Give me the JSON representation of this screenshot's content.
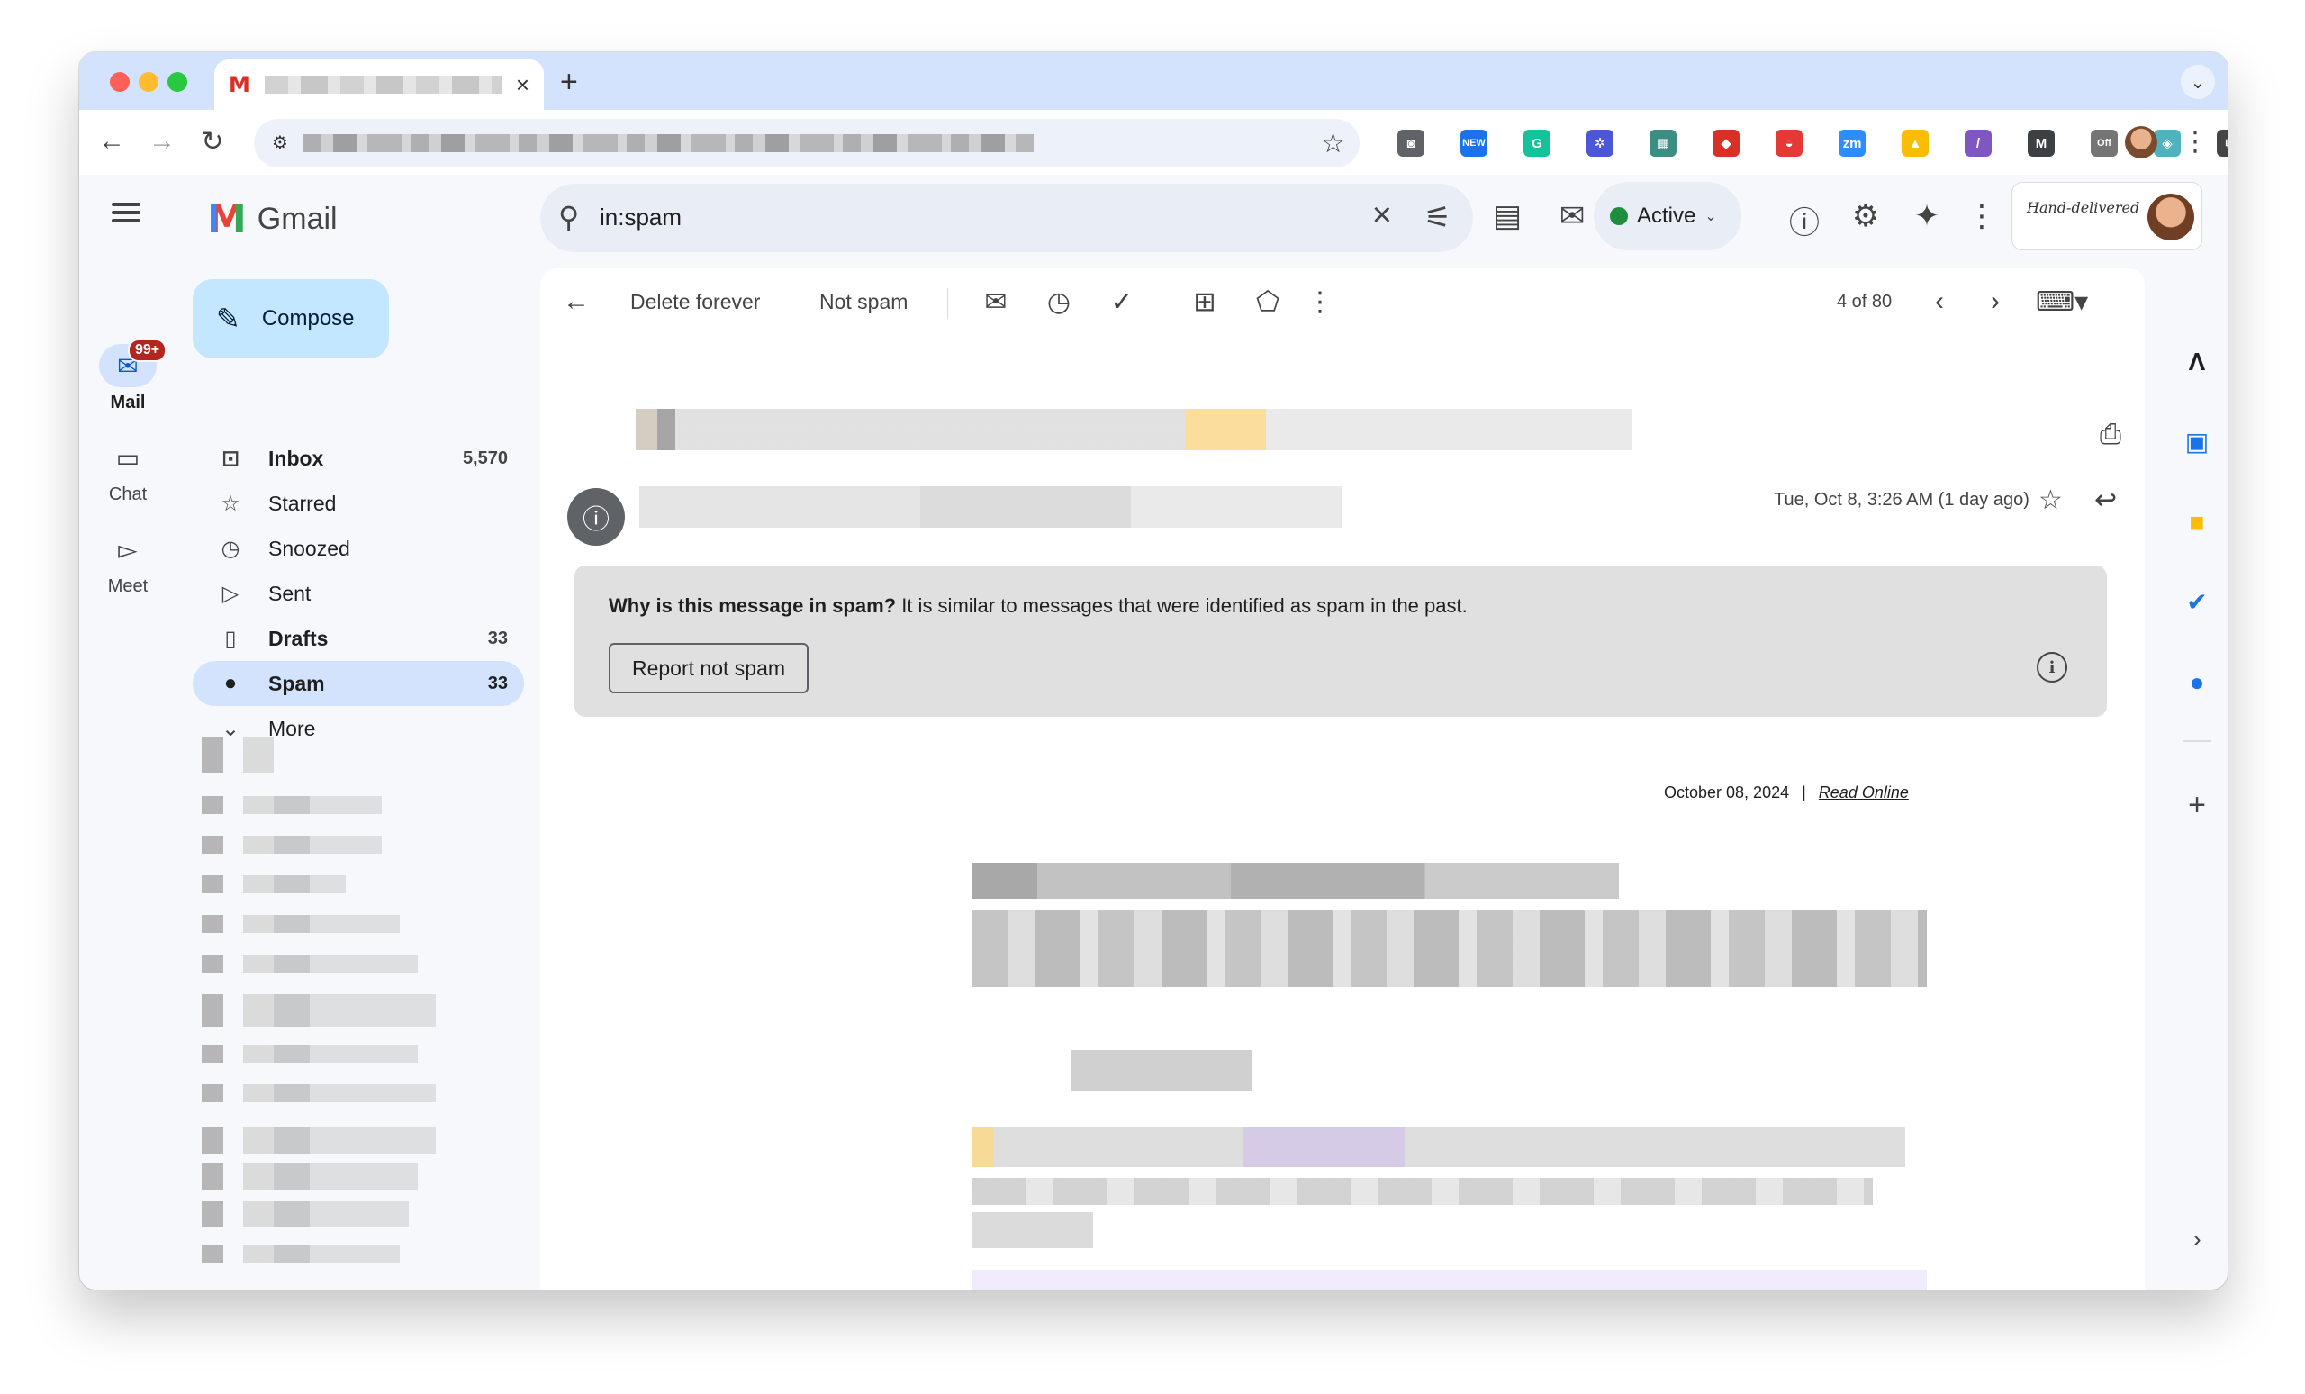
{
  "browser": {
    "new_tab_symbol": "+",
    "tab_close_symbol": "×",
    "tab_favicon_letter": "M",
    "extensions": [
      {
        "name": "camera-extension-icon",
        "color": "#5f6368",
        "glyph": "◙"
      },
      {
        "name": "new-badge-extension-icon",
        "color": "#1a73e8",
        "glyph": "NEW"
      },
      {
        "name": "grammarly-extension-icon",
        "color": "#15c39a",
        "glyph": "G"
      },
      {
        "name": "spark-extension-icon",
        "color": "#4b57d6",
        "glyph": "✲"
      },
      {
        "name": "map-extension-icon",
        "color": "#3c8e83",
        "glyph": "▦"
      },
      {
        "name": "red-square-extension-icon",
        "color": "#d93025",
        "glyph": "◆"
      },
      {
        "name": "red-pill-extension-icon",
        "color": "#e53935",
        "glyph": "◒"
      },
      {
        "name": "zoom-extension-icon",
        "color": "#2d8cff",
        "glyph": "zm"
      },
      {
        "name": "yellow-extension-icon",
        "color": "#fbbc04",
        "glyph": "▲"
      },
      {
        "name": "purple-extension-icon",
        "color": "#7e57c2",
        "glyph": "/"
      },
      {
        "name": "m-extension-icon",
        "color": "#3c4043",
        "glyph": "M"
      },
      {
        "name": "off-extension-icon",
        "color": "#757575",
        "glyph": "Off"
      },
      {
        "name": "diamond-extension-icon",
        "color": "#4fb3bf",
        "glyph": "◈"
      },
      {
        "name": "puzzle-extension-icon",
        "color": "#444444",
        "glyph": "⧉"
      }
    ]
  },
  "gmail": {
    "brand": "Gmail",
    "search": {
      "value": "in:spam"
    },
    "status": {
      "label": "Active",
      "color": "#1e8e3e"
    },
    "rail": [
      {
        "label": "Mail",
        "badge": "99+"
      },
      {
        "label": "Chat"
      },
      {
        "label": "Meet"
      }
    ],
    "compose_label": "Compose",
    "nav": [
      {
        "label": "Inbox",
        "count": "5,570"
      },
      {
        "label": "Starred",
        "count": ""
      },
      {
        "label": "Snoozed",
        "count": ""
      },
      {
        "label": "Sent",
        "count": ""
      },
      {
        "label": "Drafts",
        "count": "33"
      },
      {
        "label": "Spam",
        "count": "33"
      },
      {
        "label": "More",
        "count": ""
      }
    ],
    "actions": {
      "delete_forever": "Delete forever",
      "not_spam": "Not spam",
      "pager": "4 of 80"
    },
    "message": {
      "date": "Tue, Oct 8, 3:26 AM (1 day ago)",
      "spam_question": "Why is this message in spam?",
      "spam_reason": " It is similar to messages that were identified as spam in the past.",
      "report_not_spam": "Report not spam",
      "email_date": "October 08, 2024",
      "separator": "|",
      "read_online": "Read Online"
    },
    "account_logo_text": "Hand-delivered"
  },
  "colors": {
    "accent": "#0b57d0",
    "compose_bg": "#c2e7ff",
    "selected_nav": "#d3e3fd",
    "tabstrip": "#d3e3fd",
    "spam_panel": "#e0e0e0"
  }
}
